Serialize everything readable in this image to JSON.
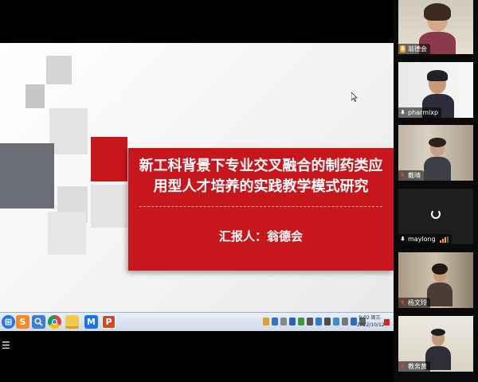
{
  "slide": {
    "title": "新工科背景下专业交叉融合的制药类应\n用型人才培养的实践教学模式研究",
    "reporter": "汇报人：翁德会",
    "banner_color": "#c8161d"
  },
  "taskbar": {
    "apps": [
      "start-orb",
      "sogou-input",
      "magnifier",
      "chrome",
      "file-explorer",
      "tencent-meeting",
      "powerpoint"
    ],
    "clock_time": "9:02 周三",
    "clock_date": "2022/10/12"
  },
  "menu_stub": "☰",
  "participants": [
    {
      "name": "翁德会",
      "mic": "on",
      "speaking": true
    },
    {
      "name": "pharmlxp",
      "mic": "on"
    },
    {
      "name": "戴晴",
      "mic": "muted"
    },
    {
      "name": "maylong",
      "mic": "on",
      "video": "loading",
      "signal": "weak"
    },
    {
      "name": "杨文玲",
      "mic": "muted"
    },
    {
      "name": "教务黄",
      "mic": "muted"
    }
  ],
  "colors": {
    "mic_on": "#ffffff",
    "mic_muted": "#e83b3b",
    "speaking_badge": "#f5a623"
  }
}
